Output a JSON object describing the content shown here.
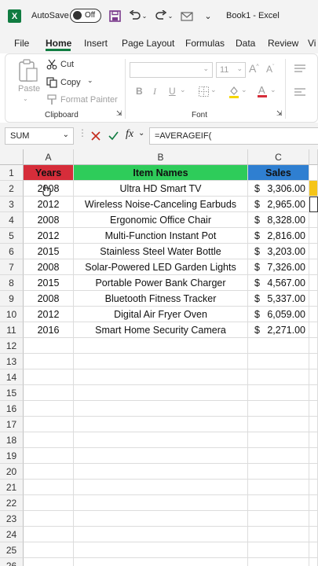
{
  "titlebar": {
    "autosave_label": "AutoSave",
    "autosave_state": "Off",
    "document_title": "Book1 - Excel"
  },
  "tabs": [
    "File",
    "Home",
    "Insert",
    "Page Layout",
    "Formulas",
    "Data",
    "Review",
    "Vi"
  ],
  "active_tab": "Home",
  "ribbon": {
    "clipboard": {
      "paste": "Paste",
      "cut": "Cut",
      "copy": "Copy",
      "format_painter": "Format Painter",
      "group_label": "Clipboard"
    },
    "font": {
      "size": "11",
      "group_label": "Font"
    }
  },
  "formula_bar": {
    "name_box": "SUM",
    "formula": "=AVERAGEIF("
  },
  "columns": [
    "A",
    "B",
    "C"
  ],
  "header_row": {
    "years": "Years",
    "item_names": "Item Names",
    "sales": "Sales"
  },
  "rows": [
    {
      "year": "2008",
      "item": "Ultra HD Smart TV",
      "currency": "$",
      "amount": "3,306.00"
    },
    {
      "year": "2012",
      "item": "Wireless Noise-Canceling Earbuds",
      "currency": "$",
      "amount": "2,965.00"
    },
    {
      "year": "2008",
      "item": "Ergonomic Office Chair",
      "currency": "$",
      "amount": "8,328.00"
    },
    {
      "year": "2012",
      "item": "Multi-Function Instant Pot",
      "currency": "$",
      "amount": "2,816.00"
    },
    {
      "year": "2015",
      "item": "Stainless Steel Water Bottle",
      "currency": "$",
      "amount": "3,203.00"
    },
    {
      "year": "2008",
      "item": "Solar-Powered LED Garden Lights",
      "currency": "$",
      "amount": "7,326.00"
    },
    {
      "year": "2015",
      "item": "Portable Power Bank Charger",
      "currency": "$",
      "amount": "4,567.00"
    },
    {
      "year": "2008",
      "item": "Bluetooth Fitness Tracker",
      "currency": "$",
      "amount": "5,337.00"
    },
    {
      "year": "2012",
      "item": "Digital Air Fryer Oven",
      "currency": "$",
      "amount": "6,059.00"
    },
    {
      "year": "2016",
      "item": "Smart Home Security Camera",
      "currency": "$",
      "amount": "2,271.00"
    }
  ],
  "row_numbers": [
    "1",
    "2",
    "3",
    "4",
    "5",
    "6",
    "7",
    "8",
    "9",
    "10",
    "11",
    "12",
    "13",
    "14",
    "15",
    "16",
    "17",
    "18",
    "19",
    "20",
    "21",
    "22",
    "23",
    "24",
    "25",
    "26"
  ],
  "colors": {
    "years_header": "#d62d3a",
    "items_header": "#2ecc5a",
    "sales_header": "#2f7fd1",
    "accent": "#107c41"
  }
}
